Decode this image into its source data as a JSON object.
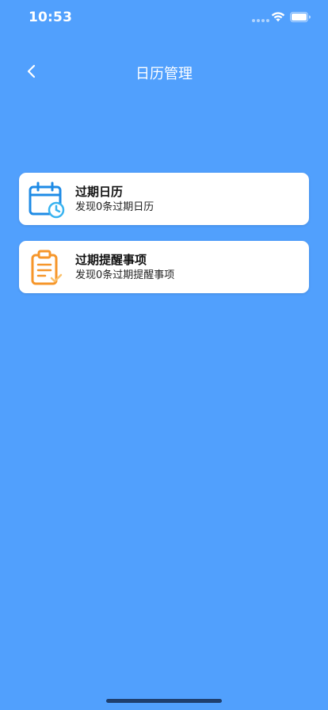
{
  "status_bar": {
    "time": "10:53"
  },
  "nav": {
    "title": "日历管理"
  },
  "cards": [
    {
      "title": "过期日历",
      "subtitle": "发现0条过期日历",
      "icon": "calendar-clock-icon",
      "icon_color": "#1e8be6"
    },
    {
      "title": "过期提醒事项",
      "subtitle": "发现0条过期提醒事项",
      "icon": "clipboard-check-icon",
      "icon_color": "#f6962a"
    }
  ],
  "colors": {
    "background": "#51a0fd",
    "card_background": "#ffffff",
    "home_indicator": "#1f3f6e"
  }
}
